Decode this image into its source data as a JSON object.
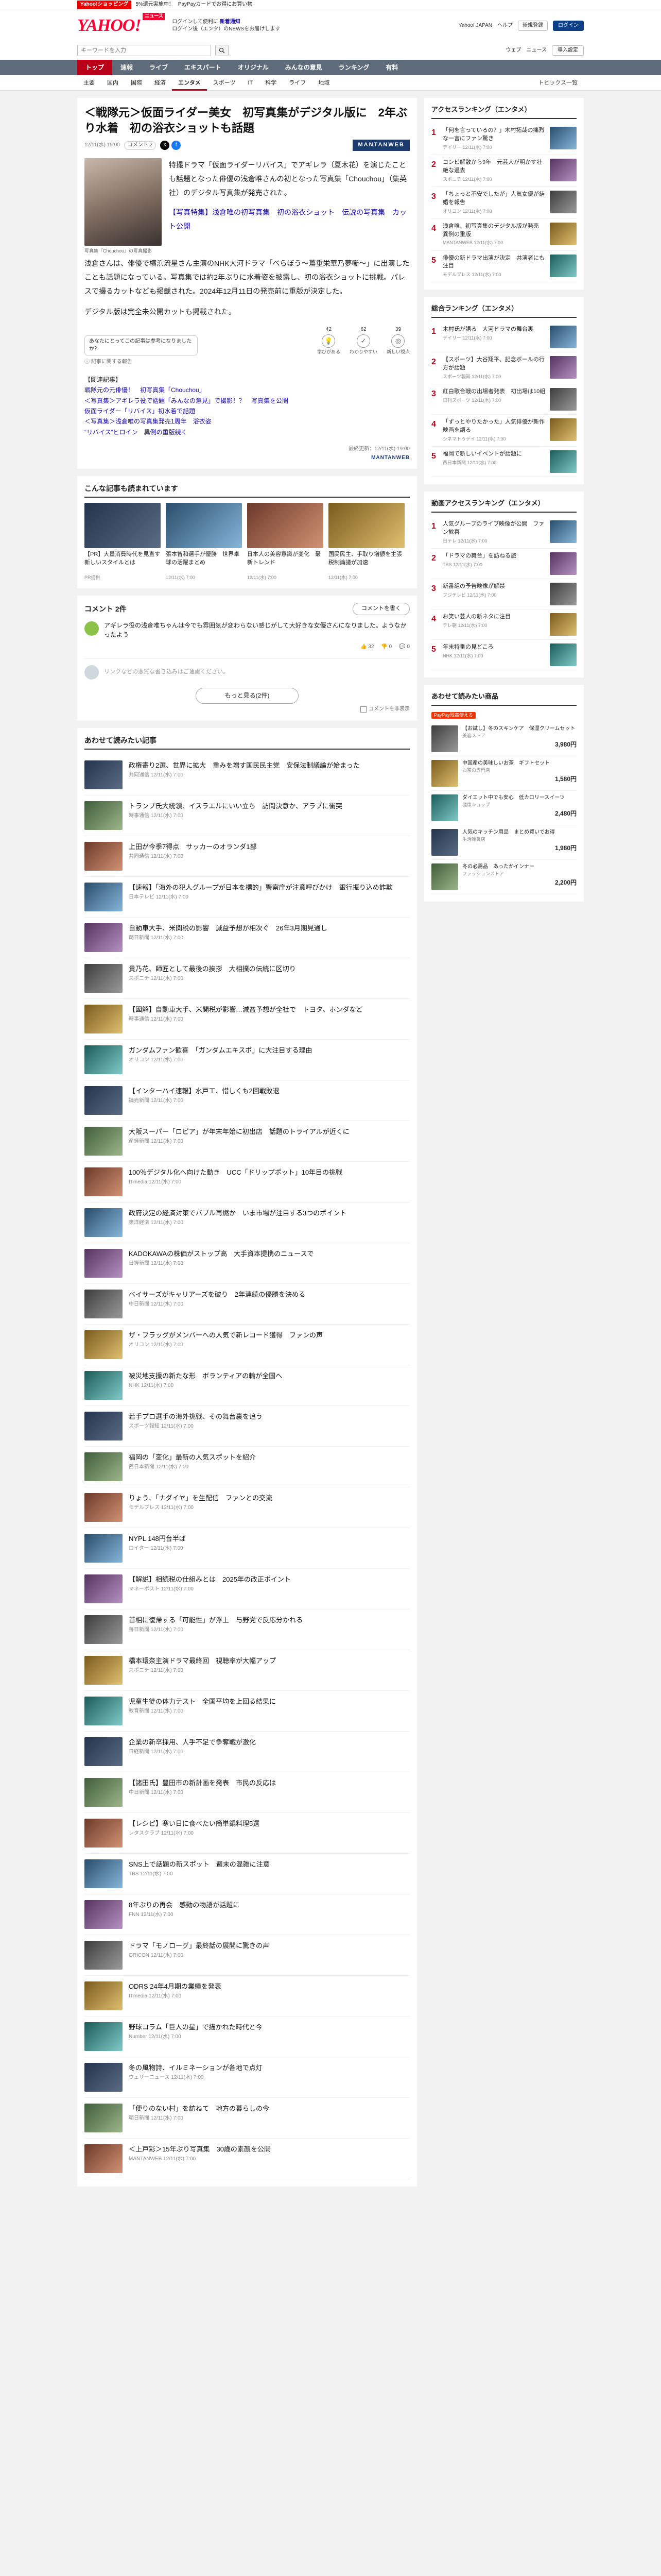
{
  "topline": {
    "badge": "Yahoo!ショッピング",
    "text": "5%還元実施中！",
    "promo": "PayPayカードでお得にお買い物"
  },
  "masthead": {
    "logo": "YAHOO!",
    "logo_sub": "ニュース",
    "msg_line1": "ログインして便利に",
    "msg_line1_link": "新着通知",
    "msg_line2": "ログイン後（エンタ）のNEWSをお届けします",
    "yjapan": "Yahoo! JAPAN",
    "help": "ヘルプ",
    "register": "新規登録",
    "login": "ログイン"
  },
  "search": {
    "placeholder": "キーワードを入力",
    "web": "ウェブ",
    "news": "ニュース",
    "entry": "導入設定"
  },
  "gnav": [
    "トップ",
    "速報",
    "ライブ",
    "エキスパート",
    "オリジナル",
    "みんなの意見",
    "ランキング",
    "有料"
  ],
  "subnav": [
    "主要",
    "国内",
    "国際",
    "経済",
    "エンタメ",
    "スポーツ",
    "IT",
    "科学",
    "ライフ",
    "地域"
  ],
  "subnav_topics": "トピックス一覧",
  "article": {
    "title": "＜戦隊元＞仮面ライダー美女　初写真集がデジタル版に　2年ぶり水着　初の浴衣ショットも話題",
    "date": "12/11(水) 19:00",
    "comments_pill": "コメント 2",
    "source": "MANTANWEB",
    "photo_caption": "写真集『Chouchou』の写真撮影",
    "p1": "特撮ドラマ「仮面ライダーリバイス」でアギレラ（夏木花）を演じたことも話題となった俳優の浅倉唯さんの初となった写真集「Chouchou」（集英社）のデジタル写真集が発売された。",
    "p2_link": "【写真特集】浅倉唯の初写真集　初の浴衣ショット　伝説の写真集　カット公開",
    "body1": "浅倉さんは、俳優で横浜流星さん主演のNHK大河ドラマ「べらぼう〜蔦重栄華乃夢噺〜」に出演したことも話題になっている。写真集では約2年ぶりに水着姿を披露し、初の浴衣ショットに挑戦。パレスで撮るカットなども掲載された。2024年12月11日の発売前に重版が決定した。",
    "body2": "デジタル版は完全未公開カットも掲載された。",
    "bubble": "あなたにとってこの記事は参考になりましたか？",
    "reactions": [
      {
        "label": "学びがある",
        "count": "42",
        "icon": "lightbulb-icon",
        "glyph": "💡"
      },
      {
        "label": "わかりやすい",
        "count": "62",
        "icon": "check-icon",
        "glyph": "✓"
      },
      {
        "label": "新しい視点",
        "count": "39",
        "icon": "eye-icon",
        "glyph": "◎"
      }
    ],
    "notice": "ⓘ 記事に関する報告",
    "related_head": "【関連記事】",
    "related": [
      "戦隊元の元俳優！　初写真集「Chouchou」",
      "＜写真集＞アギレラ役で話題「みんなの意見」で撮影！？　写真集を公開",
      "仮面ライダー「リバイス」初水着で話題",
      "＜写真集＞浅倉唯の写真集発売1周年　浴衣姿",
      "“リバイス”ヒロイン　異例の重版続く"
    ],
    "credit_date": "最終更新：12/11(水) 19:00",
    "credit_src": "MANTANWEB"
  },
  "reads": {
    "title": "こんな記事も読まれています",
    "items": [
      {
        "t": "【PR】大量消費時代を見直す新しいスタイルとは",
        "s": "PR提供"
      },
      {
        "t": "張本智和選手が優勝　世界卓球の活躍まとめ",
        "s": "12/11(水) 7:00"
      },
      {
        "t": "日本人の美容意識が変化　最新トレンド",
        "s": "12/11(水) 7:00"
      },
      {
        "t": "国民民主、手取り増額を主張　税制論議が加速",
        "s": "12/11(水) 7:00"
      }
    ]
  },
  "comments": {
    "title": "コメント 2件",
    "write": "コメントを書く",
    "item1": "アギレラ役の浅倉唯ちゃんは今でも雰囲気が変わらない感じがして大好きな女優さんになりました。ようなかったよう",
    "like_count": "32",
    "dislike_count": "0",
    "reply_count": "0",
    "input_placeholder": "リンクなどの悪質な書き込みはご遠慮ください。",
    "more": "もっと見る(2件)",
    "option": "コメントを非表示"
  },
  "feed": {
    "title": "あわせて読みたい記事",
    "items": [
      {
        "t": "政権寄り2選、世界に拡大　重みを増す国民民主党　安保法制議論が始まった",
        "s": "共同通信 12/11(水) 7:00"
      },
      {
        "t": "トランプ氏大統領、イスラエルにいい立ち　訪問決意か、アラブに衝突",
        "s": "時事通信 12/11(水) 7:00"
      },
      {
        "t": "上田が今季7得点　サッカーのオランダ1部",
        "s": "共同通信 12/11(水) 7:00"
      },
      {
        "t": "【速報】「海外の犯人グループが日本を標的」警察庁が注意呼びかけ　銀行振り込め詐欺",
        "s": "日本テレビ 12/11(水) 7:00"
      },
      {
        "t": "自動車大手、米関税の影響　減益予想が相次ぐ　26年3月期見通し",
        "s": "朝日新聞 12/11(水) 7:00"
      },
      {
        "t": "貴乃花、師匠として最後の挨拶　大相撲の伝統に区切り",
        "s": "スポニチ 12/11(水) 7:00"
      },
      {
        "t": "【図解】自動車大手、米関税が影響…減益予想が全社で　トヨタ、ホンダなど",
        "s": "時事通信 12/11(水) 7:00"
      },
      {
        "t": "ガンダムファン歓喜　「ガンダムエキスポ」に大注目する理由",
        "s": "オリコン 12/11(水) 7:00"
      },
      {
        "t": "【インターハイ速報】水戸工、惜しくも2回戦敗退",
        "s": "読売新聞 12/11(水) 7:00"
      },
      {
        "t": "大阪スーパー「ロピア」が年末年始に初出店　話題のトライアルが近くに",
        "s": "産経新聞 12/11(水) 7:00"
      },
      {
        "t": "100％デジタル化へ向けた動き　UCC「ドリップポット」10年目の挑戦",
        "s": "ITmedia 12/11(水) 7:00"
      },
      {
        "t": "政府決定の経済対策でバブル再燃か　いま市場が注目する3つのポイント",
        "s": "東洋経済 12/11(水) 7:00"
      },
      {
        "t": "KADOKAWAの株価がストップ高　大手資本提携のニュースで",
        "s": "日経新聞 12/11(水) 7:00"
      },
      {
        "t": "ベイサーズがキャリアーズを破り　2年連続の優勝を決める",
        "s": "中日新聞 12/11(水) 7:00"
      },
      {
        "t": "ザ・フラッグがメンバーへの人気で新レコード獲得　ファンの声",
        "s": "オリコン 12/11(水) 7:00"
      },
      {
        "t": "被災地支援の新たな形　ボランティアの輪が全国へ",
        "s": "NHK 12/11(水) 7:00"
      },
      {
        "t": "若手プロ選手の海外挑戦、その舞台裏を追う",
        "s": "スポーツ報知 12/11(水) 7:00"
      },
      {
        "t": "福岡の「変化」最新の人気スポットを紹介",
        "s": "西日本新聞 12/11(水) 7:00"
      },
      {
        "t": "りょう、「ナダイヤ」を生配信　ファンとの交流",
        "s": "モデルプレス 12/11(水) 7:00"
      },
      {
        "t": "NYPL 148円台半ば",
        "s": "ロイター 12/11(水) 7:00"
      },
      {
        "t": "【解説】相続税の仕組みとは　2025年の改正ポイント",
        "s": "マネーポスト 12/11(水) 7:00"
      },
      {
        "t": "首相に復帰する「可能性」が浮上　与野党で反応分かれる",
        "s": "毎日新聞 12/11(水) 7:00"
      },
      {
        "t": "橋本環奈主演ドラマ最終回　視聴率が大幅アップ",
        "s": "スポニチ 12/11(水) 7:00"
      },
      {
        "t": "児童生徒の体力テスト　全国平均を上回る結果に",
        "s": "教育新聞 12/11(水) 7:00"
      },
      {
        "t": "企業の新卒採用、人手不足で争奪戦が激化",
        "s": "日経新聞 12/11(水) 7:00"
      },
      {
        "t": "【諸田氏】豊田市の新計画を発表　市民の反応は",
        "s": "中日新聞 12/11(水) 7:00"
      },
      {
        "t": "【レシピ】寒い日に食べたい簡単鍋料理5選",
        "s": "レタスクラブ 12/11(水) 7:00"
      },
      {
        "t": "SNS上で話題の新スポット　週末の混雑に注意",
        "s": "TBS 12/11(水) 7:00"
      },
      {
        "t": "8年ぶりの再会　感動の物語が話題に",
        "s": "FNN 12/11(水) 7:00"
      },
      {
        "t": "ドラマ「モノローグ」最終話の展開に驚きの声",
        "s": "ORICON 12/11(水) 7:00"
      },
      {
        "t": "ODRS 24年4月期の業績を発表",
        "s": "ITmedia 12/11(水) 7:00"
      },
      {
        "t": "野球コラム「巨人の星」で描かれた時代と今",
        "s": "Number 12/11(水) 7:00"
      },
      {
        "t": "冬の風物詩、イルミネーションが各地で点灯",
        "s": "ウェザーニュース 12/11(水) 7:00"
      },
      {
        "t": "「便りのない村」を訪ねて　地方の暮らしの今",
        "s": "朝日新聞 12/11(水) 7:00"
      },
      {
        "t": "＜上戸彩＞15年ぶり写真集　30歳の素顔を公開",
        "s": "MANTANWEB 12/11(水) 7:00"
      }
    ]
  },
  "side": {
    "access_title": "アクセスランキング（エンタメ）",
    "access": [
      {
        "t": "「何を言っているの？」木村拓哉の痛烈な一言にファン驚き",
        "s": "デイリー 12/11(水) 7:00"
      },
      {
        "t": "コンビ解散から9年　元芸人が明かす壮絶な過去",
        "s": "スポニチ 12/11(水) 7:00"
      },
      {
        "t": "「ちょっと不安でしたが」人気女優が結婚を報告",
        "s": "オリコン 12/11(水) 7:00"
      },
      {
        "t": "浅倉唯、初写真集のデジタル版が発売　異例の重版",
        "s": "MANTANWEB 12/11(水) 7:00"
      },
      {
        "t": "俳優の新ドラマ出演が決定　共演者にも注目",
        "s": "モデルプレス 12/11(水) 7:00"
      }
    ],
    "ranking_title": "総合ランキング（エンタメ）",
    "ranking": [
      {
        "t": "木村氏が語る　大河ドラマの舞台裏",
        "s": "デイリー 12/11(水) 7:00"
      },
      {
        "t": "【スポーツ】大谷翔平、記念ボールの行方が話題",
        "s": "スポーツ報知 12/11(水) 7:00"
      },
      {
        "t": "紅白歌合戦の出場者発表　初出場は10組",
        "s": "日刊スポーツ 12/11(水) 7:00"
      },
      {
        "t": "「ずっとやりたかった」人気俳優が新作映画を語る",
        "s": "シネマトゥデイ 12/11(水) 7:00"
      },
      {
        "t": "福岡で新しいイベントが話題に",
        "s": "西日本新聞 12/11(水) 7:00"
      }
    ],
    "daily_title": "動画アクセスランキング（エンタメ）",
    "daily": [
      {
        "t": "人気グループのライブ映像が公開　ファン歓喜",
        "s": "日テレ 12/11(水) 7:00"
      },
      {
        "t": "「ドラマの舞台」を訪ねる旅",
        "s": "TBS 12/11(水) 7:00"
      },
      {
        "t": "新番組の予告映像が解禁",
        "s": "フジテレビ 12/11(水) 7:00"
      },
      {
        "t": "お笑い芸人の新ネタに注目",
        "s": "テレ朝 12/11(水) 7:00"
      },
      {
        "t": "年末特番の見どころ",
        "s": "NHK 12/11(水) 7:00"
      }
    ],
    "shop_title": "あわせて読みたい商品",
    "shop_badge": "PayPay残高使える",
    "shop": [
      {
        "t": "【お試し】冬のスキンケア　保湿クリームセット",
        "s": "美容ストア",
        "p": "3,980円"
      },
      {
        "t": "中国産の美味しいお茶　ギフトセット",
        "s": "お茶の専門店",
        "p": "1,580円"
      },
      {
        "t": "ダイエット中でも安心　低カロリースイーツ",
        "s": "健康ショップ",
        "p": "2,480円"
      },
      {
        "t": "人気のキッチン用品　まとめ買いでお得",
        "s": "生活雑貨店",
        "p": "1,980円"
      },
      {
        "t": "冬の必需品　あったかインナー",
        "s": "ファッションストア",
        "p": "2,200円"
      }
    ]
  }
}
